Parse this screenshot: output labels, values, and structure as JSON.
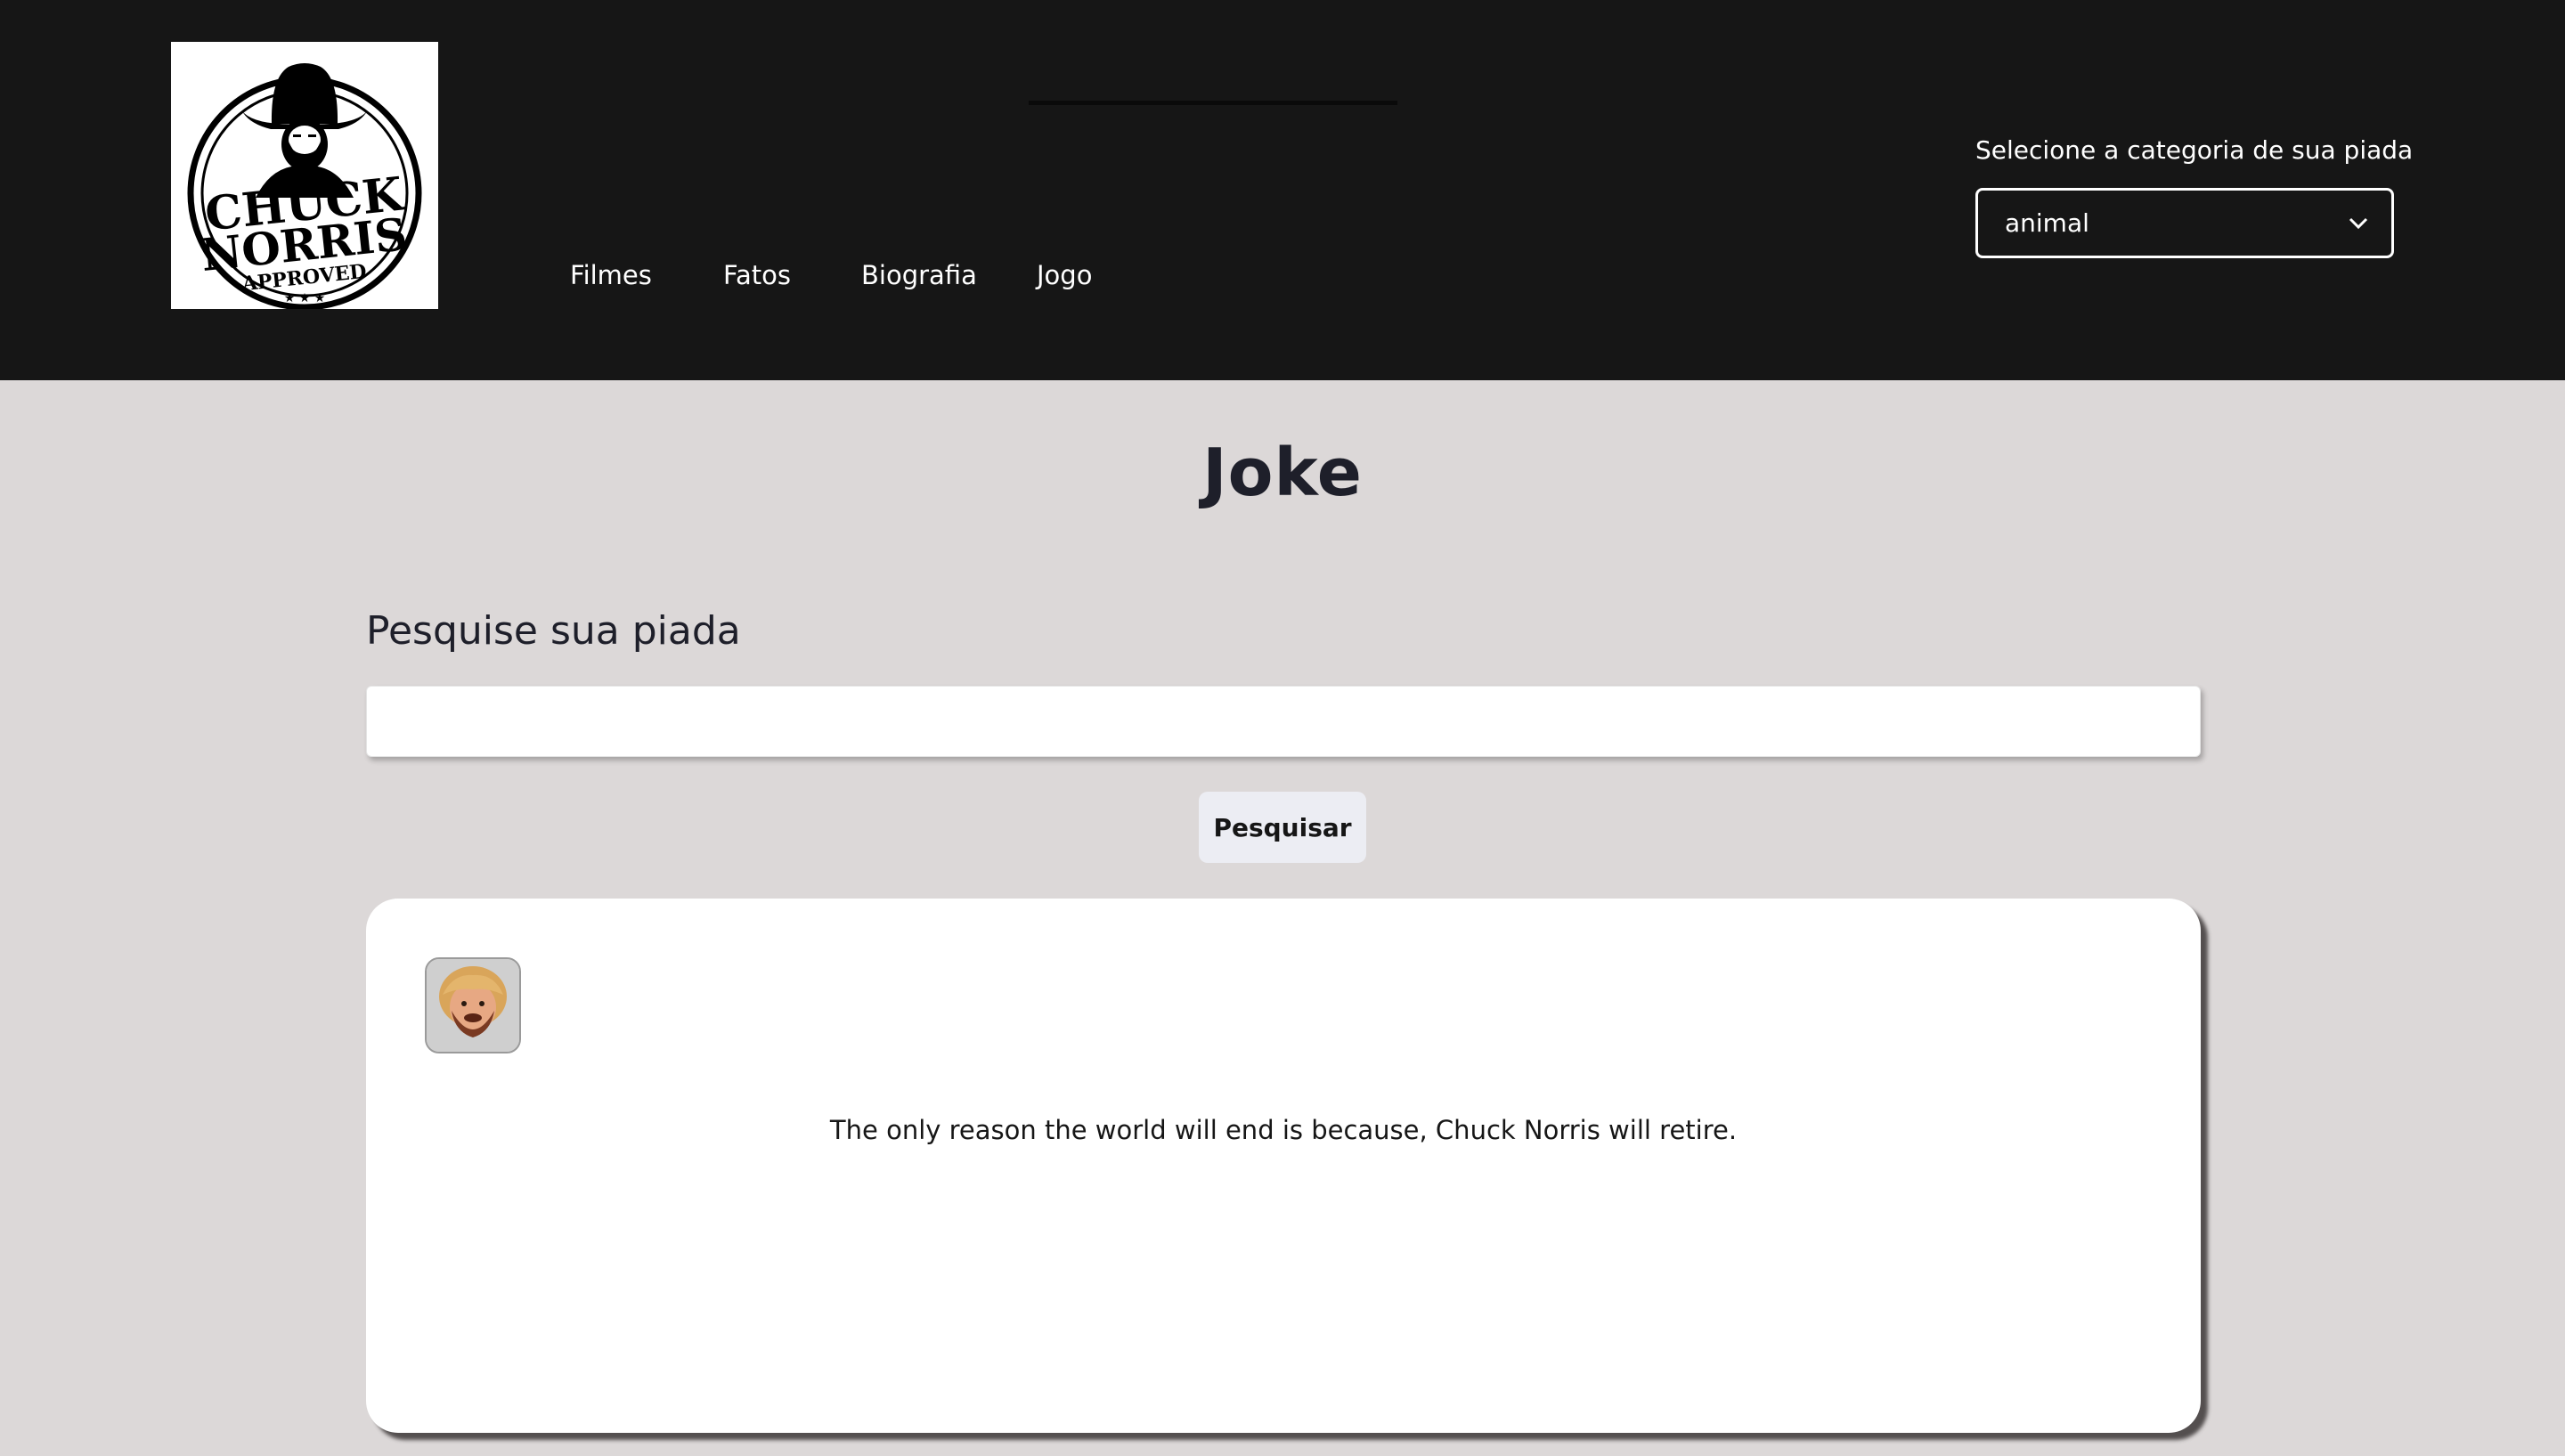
{
  "header": {
    "logo": {
      "line1": "CHUCK",
      "line2": "NORRIS",
      "line3": "APPROVED",
      "stars": "★ ★ ★"
    },
    "nav": [
      {
        "label": "Filmes"
      },
      {
        "label": "Fatos"
      },
      {
        "label": "Biografia"
      },
      {
        "label": "Jogo"
      }
    ],
    "category_label": "Selecione a categoria de sua piada",
    "category_selected": "animal"
  },
  "main": {
    "title": "Joke",
    "search_label": "Pesquise sua piada",
    "search_value": "",
    "search_placeholder": "",
    "search_button": "Pesquisar",
    "joke_text": "The only reason the world will end is because, Chuck Norris will retire."
  },
  "colors": {
    "header_bg": "#161616",
    "page_bg": "#dcd8d8",
    "card_bg": "#ffffff",
    "text_dark": "#1e1f2a",
    "button_bg": "#ecedf3"
  },
  "icons": {
    "logo": "chuck-norris-approved-logo",
    "select_chevron": "chevron-down-icon",
    "avatar": "chuck-norris-avatar-icon"
  }
}
